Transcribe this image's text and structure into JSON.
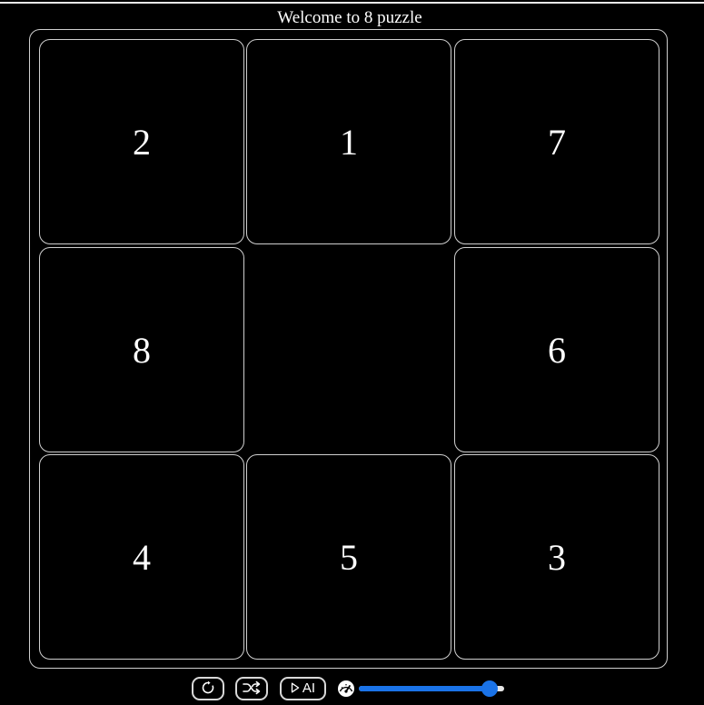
{
  "title": "Welcome to 8 puzzle",
  "board": {
    "tiles": [
      {
        "label": "2"
      },
      {
        "label": "1"
      },
      {
        "label": "7"
      },
      {
        "label": "8"
      },
      {
        "label": ""
      },
      {
        "label": "6"
      },
      {
        "label": "4"
      },
      {
        "label": "5"
      },
      {
        "label": "3"
      }
    ]
  },
  "controls": {
    "reset_icon": "reset-icon",
    "shuffle_icon": "shuffle-icon",
    "ai_label": "AI",
    "ai_icon": "play-icon",
    "speed_icon": "speedometer-icon",
    "speed_value": 0.9
  },
  "colors": {
    "background": "#000000",
    "border": "#cfcfcf",
    "accent": "#1a73e8"
  }
}
